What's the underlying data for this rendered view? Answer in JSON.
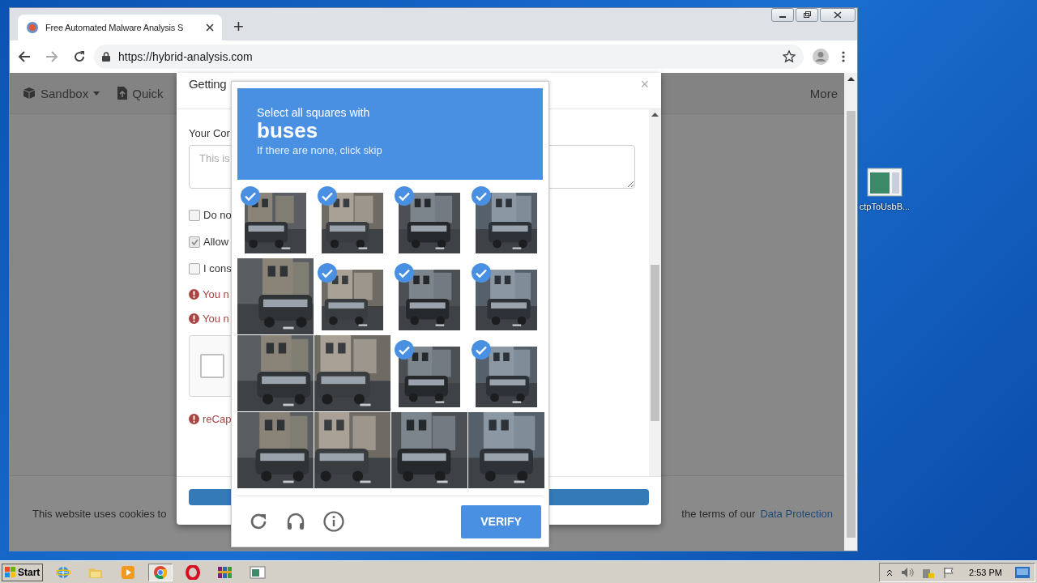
{
  "browser": {
    "tab_title": "Free Automated Malware Analysis S",
    "new_tab": "+",
    "url": "https://hybrid-analysis.com"
  },
  "navbar": {
    "items": [
      {
        "label": "Sandbox"
      },
      {
        "label": "Quick"
      }
    ],
    "more": "More"
  },
  "modal": {
    "title": "Getting",
    "close": "×",
    "comment_label": "Your Cor",
    "comment_placeholder": "This is",
    "checkboxes": [
      {
        "label": "Do no",
        "checked": false
      },
      {
        "label": "Allow",
        "checked": true
      },
      {
        "label": "I cons",
        "checked": false
      }
    ],
    "errors": [
      "You n",
      "You n"
    ],
    "recaptcha_checked": false,
    "recaptcha_error": "reCap"
  },
  "cookie_bar": {
    "text_start": "This website uses cookies to",
    "text_end": "the terms of our",
    "link": "Data Protection"
  },
  "captcha": {
    "prompt": "Select all squares with",
    "target": "buses",
    "hint": "If there are none, click skip",
    "verify": "VERIFY",
    "tiles": [
      {
        "kind": "picture",
        "selected": true
      },
      {
        "kind": "picture",
        "selected": true
      },
      {
        "kind": "picture",
        "selected": true
      },
      {
        "kind": "picture",
        "selected": true
      },
      {
        "kind": "picture",
        "selected": false
      },
      {
        "kind": "picture",
        "selected": true
      },
      {
        "kind": "picture",
        "selected": true
      },
      {
        "kind": "picture",
        "selected": true
      },
      {
        "kind": "picture",
        "selected": false
      },
      {
        "kind": "picture",
        "selected": false
      },
      {
        "kind": "picture",
        "selected": true
      },
      {
        "kind": "picture",
        "selected": true
      },
      {
        "kind": "picture",
        "selected": false
      },
      {
        "kind": "picture",
        "selected": false
      },
      {
        "kind": "picture",
        "selected": false
      },
      {
        "kind": "picture",
        "selected": false
      }
    ]
  },
  "desktop": {
    "icons": [
      {
        "label": "ctpToUsbB..."
      }
    ]
  },
  "taskbar": {
    "start": "Start",
    "apps": [
      {
        "kind": "ie",
        "selected": false
      },
      {
        "kind": "folder",
        "selected": false
      },
      {
        "kind": "media",
        "selected": false
      },
      {
        "kind": "chrome",
        "selected": true
      },
      {
        "kind": "opera",
        "selected": false
      },
      {
        "kind": "archive",
        "selected": false
      },
      {
        "kind": "window",
        "selected": false
      }
    ],
    "clock": "2:53 PM"
  }
}
